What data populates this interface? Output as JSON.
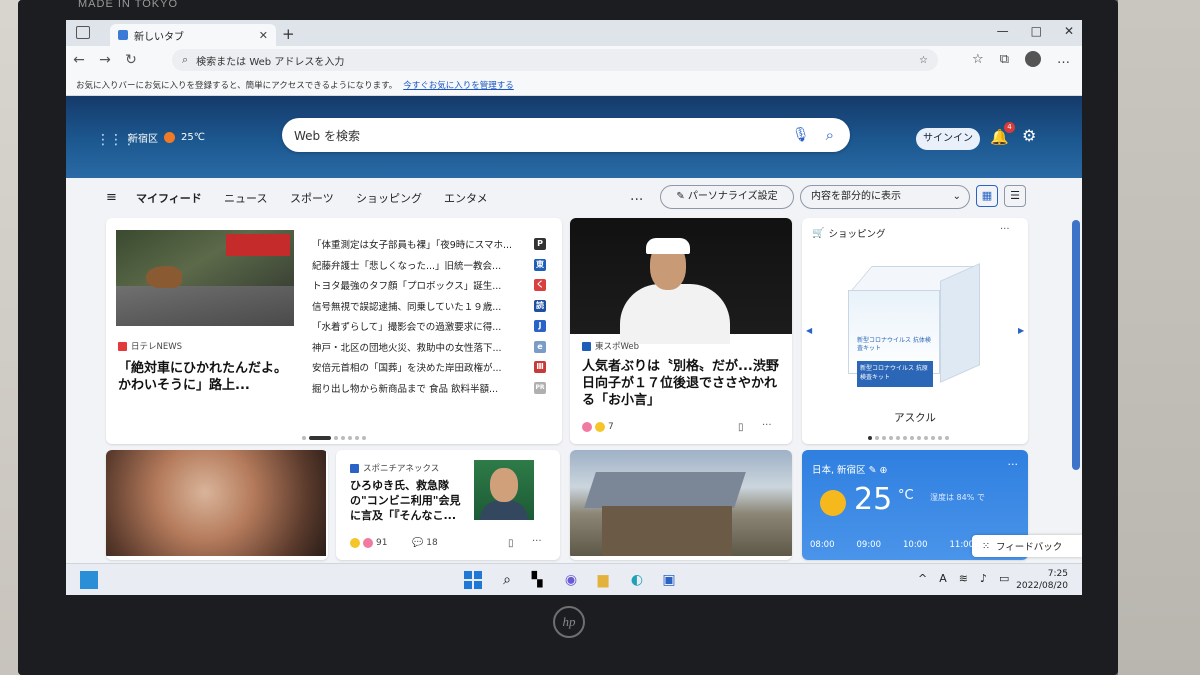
{
  "frame": {
    "bezel_text": "MADE IN TOKYO",
    "brand": "hp"
  },
  "browser": {
    "tab_title": "新しいタブ",
    "address_placeholder": "検索または Web アドレスを入力",
    "favbar_text": "お気に入りバーにお気に入りを登録すると、簡単にアクセスできるようになります。",
    "favbar_link": "今すぐお気に入りを管理する"
  },
  "hero": {
    "location": "新宿区",
    "temp": "25℃",
    "search_placeholder": "Web を検索",
    "signin": "サインイン",
    "notif_count": "4"
  },
  "feed_nav": {
    "items": [
      "マイフィード",
      "ニュース",
      "スポーツ",
      "ショッピング",
      "エンタメ"
    ],
    "more": "...",
    "personalize": "パーソナライズ設定",
    "display_mode": "内容を部分的に表示"
  },
  "card1": {
    "source": "日テレNEWS",
    "headline": "「絶対車にひかれたんだよ。かわいそうに」路上...",
    "list": [
      {
        "text": "「体重測定は女子部員も裸」「夜9時にスマホ...",
        "badge": "P",
        "color": "#333333"
      },
      {
        "text": "紀藤弁護士「悲しくなった...」旧統一教会...",
        "badge": "東",
        "color": "#1d5fb8"
      },
      {
        "text": "トヨタ最強のタフ顔「プロボックス」誕生...",
        "badge": "く",
        "color": "#d94040"
      },
      {
        "text": "信号無視で誤認逮捕、同乗していた１９歳...",
        "badge": "読",
        "color": "#1f4fa0"
      },
      {
        "text": "「水着ずらして」撮影会での過激要求に得...",
        "badge": "J",
        "color": "#2a63c7"
      },
      {
        "text": "神戸・北区の団地火災、救助中の女性落下...",
        "badge": "e",
        "color": "#7a9cc7"
      },
      {
        "text": "安倍元首相の「国葬」を決めた岸田政権が...",
        "badge": "Ⅲ",
        "color": "#c83a3a"
      },
      {
        "text": "掘り出し物から新商品まで 食品 飲料半額...",
        "badge": "PR",
        "color": "#b0b0b0"
      }
    ]
  },
  "card2": {
    "source": "東スポWeb",
    "headline": "人気者ぶりは〝別格〟だが...渋野日向子が１７位後退でささやかれる「お小言」",
    "reactions": "7"
  },
  "card3": {
    "section": "ショッピング",
    "box_top_text": "新型コロナウイルス 抗体検査キット",
    "box_band_text": "新型コロナウイルス 抗原検査キット",
    "product": "アスクル"
  },
  "card5": {
    "source": "スポニチアネックス",
    "headline": "ひろゆき氏、救急隊の\"コンビニ利用\"会見に言及「『そんなこ...",
    "reactions": "91",
    "comments": "18"
  },
  "weather": {
    "location": "日本, 新宿区",
    "temp": "25",
    "unit": "°C",
    "humidity": "湿度は 84% で",
    "hours": [
      "08:00",
      "09:00",
      "10:00",
      "11:00"
    ]
  },
  "feedback": "フィードバック",
  "taskbar": {
    "time": "7:25",
    "date": "2022/08/20"
  }
}
